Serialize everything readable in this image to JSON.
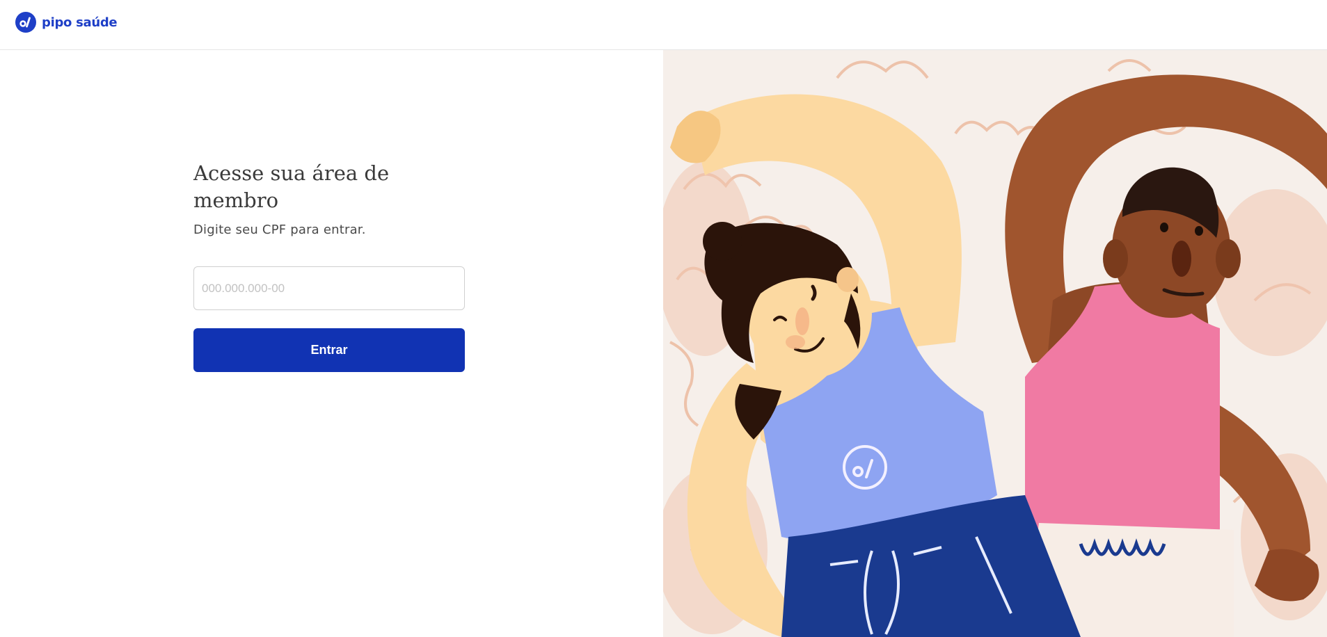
{
  "brand": {
    "name": "pipo saúde",
    "color": "#1e3fc7"
  },
  "login": {
    "title": "Acesse sua área de membro",
    "subtitle": "Digite seu CPF para entrar.",
    "cpf_placeholder": "000.000.000-00",
    "cpf_value": "",
    "submit_label": "Entrar",
    "button_color": "#1133b3"
  },
  "illustration": {
    "icon": "two-people-stretching-illustration"
  }
}
